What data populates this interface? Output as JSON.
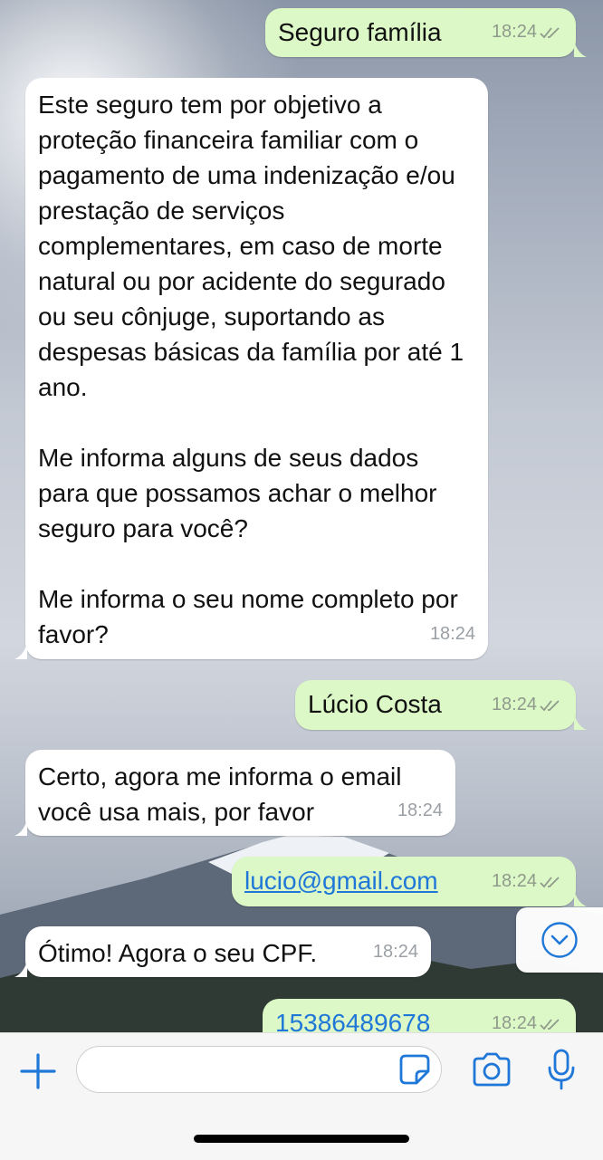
{
  "messages": [
    {
      "dir": "out",
      "text": "Seguro família",
      "time": "18:24"
    },
    {
      "dir": "in",
      "text": "Este seguro tem por objetivo a proteção financeira familiar com o pagamento de uma indenização e/ou prestação de serviços complementares, em caso de morte natural ou por acidente do segurado ou seu cônjuge, suportando as despesas básicas da família por até 1 ano.\n\nMe informa alguns de seus dados para que possamos achar o melhor seguro para você?\n\nMe informa o seu nome completo por favor?",
      "time": "18:24"
    },
    {
      "dir": "out",
      "text": "Lúcio Costa",
      "time": "18:24"
    },
    {
      "dir": "in",
      "text": "Certo, agora me informa o email você usa mais, por favor",
      "time": "18:24"
    },
    {
      "dir": "out",
      "text": "lucio@gmail.com",
      "time": "18:24"
    },
    {
      "dir": "in",
      "text": "Ótimo! Agora o seu CPF.",
      "time": "18:24"
    },
    {
      "dir": "out",
      "text": "15386489678",
      "time": "18:24"
    }
  ],
  "colors": {
    "outgoing_bubble": "#dcf8c6",
    "incoming_bubble": "#ffffff",
    "accent": "#1f77d8"
  },
  "icons": [
    "read-receipt-icon",
    "chevron-down-icon",
    "plus-icon",
    "sticker-icon",
    "camera-icon",
    "microphone-icon"
  ],
  "composer": {
    "placeholder": ""
  }
}
